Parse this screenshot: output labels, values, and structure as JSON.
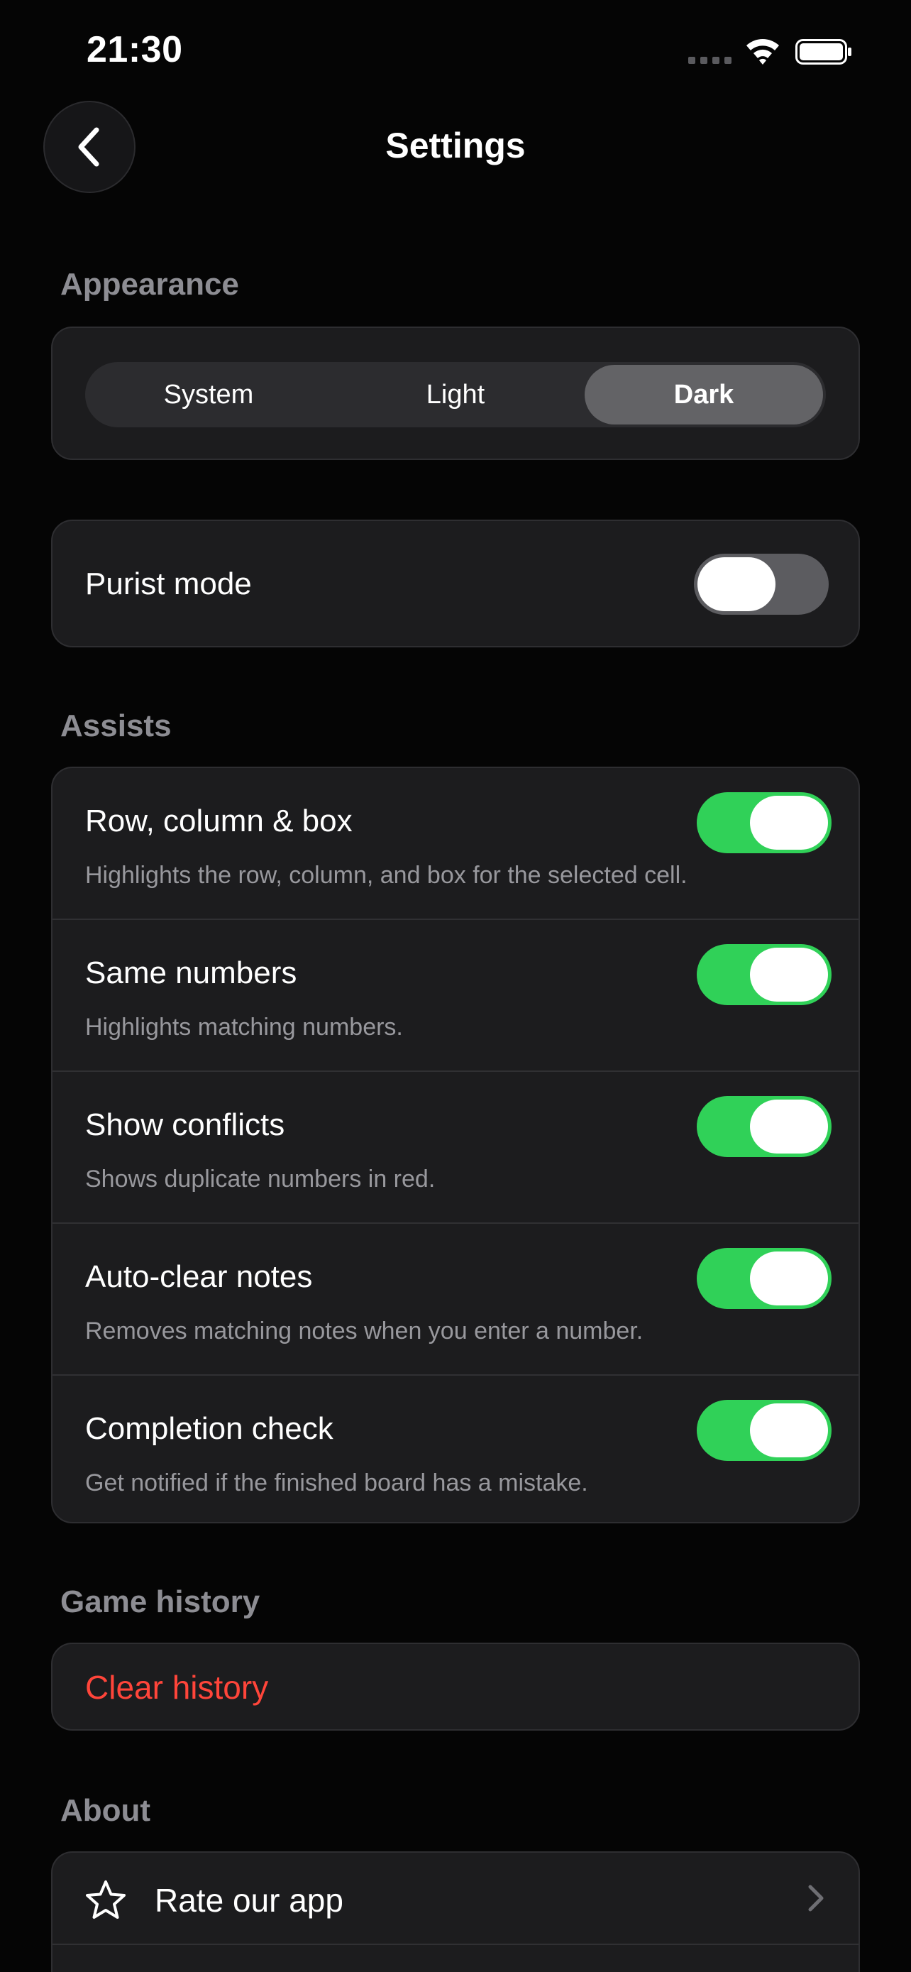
{
  "status_bar": {
    "time": "21:30"
  },
  "nav": {
    "title": "Settings"
  },
  "appearance": {
    "header": "Appearance",
    "options": [
      "System",
      "Light",
      "Dark"
    ],
    "selected": "Dark"
  },
  "purist": {
    "label": "Purist mode",
    "enabled": false
  },
  "assists": {
    "header": "Assists",
    "items": [
      {
        "title": "Row, column & box",
        "subtitle": "Highlights the row, column, and box for the selected cell.",
        "enabled": true
      },
      {
        "title": "Same numbers",
        "subtitle": "Highlights matching numbers.",
        "enabled": true
      },
      {
        "title": "Show conflicts",
        "subtitle": "Shows duplicate numbers in red.",
        "enabled": true
      },
      {
        "title": "Auto-clear notes",
        "subtitle": "Removes matching notes when you enter a number.",
        "enabled": true
      },
      {
        "title": "Completion check",
        "subtitle": "Get notified if the finished board has a mistake.",
        "enabled": true
      }
    ]
  },
  "history": {
    "header": "Game history",
    "clear_label": "Clear history"
  },
  "about": {
    "header": "About",
    "items": [
      {
        "label": "Rate our app",
        "icon": "star-icon"
      }
    ]
  },
  "colors": {
    "accent_green": "#30d158",
    "danger_red": "#ff453a",
    "background": "#050505",
    "card": "#1c1c1e"
  }
}
